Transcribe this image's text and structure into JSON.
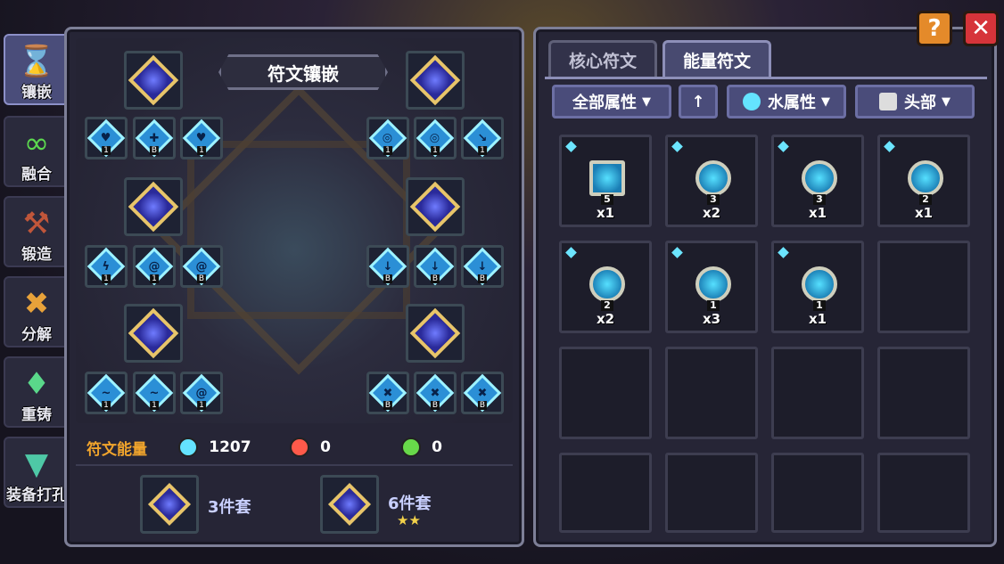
{
  "side_menu": [
    {
      "label": "镶嵌",
      "icon": "inlay-icon",
      "active": true
    },
    {
      "label": "融合",
      "icon": "fusion-icon",
      "active": false
    },
    {
      "label": "锻造",
      "icon": "forge-icon",
      "active": false
    },
    {
      "label": "分解",
      "icon": "decompose-icon",
      "active": false
    },
    {
      "label": "重铸",
      "icon": "recast-icon",
      "active": false
    },
    {
      "label": "装备打孔",
      "icon": "drill-icon",
      "active": false
    }
  ],
  "left_panel": {
    "title": "符文镶嵌",
    "core_slots": 6,
    "rune_rows": [
      {
        "left": [
          "1",
          "B",
          "1"
        ],
        "right": [
          "1",
          "1",
          "1"
        ]
      },
      {
        "left": [
          "1",
          "1",
          "B"
        ],
        "right": [
          "B",
          "B",
          "B"
        ]
      },
      {
        "left": [
          "1",
          "1",
          "1"
        ],
        "right": [
          "B",
          "B",
          "B"
        ]
      }
    ],
    "energy": {
      "title": "符文能量",
      "items": [
        {
          "icon": "water-energy-icon",
          "color": "#64e3ff",
          "value": "1207"
        },
        {
          "icon": "fire-energy-icon",
          "color": "#ff5a4a",
          "value": "0"
        },
        {
          "icon": "nature-energy-icon",
          "color": "#68d94a",
          "value": "0"
        }
      ]
    },
    "sets": [
      {
        "label": "3件套",
        "stars": ""
      },
      {
        "label": "6件套",
        "stars": "★★"
      }
    ]
  },
  "right_panel": {
    "tabs": [
      {
        "label": "核心符文",
        "active": false
      },
      {
        "label": "能量符文",
        "active": true
      }
    ],
    "filters": {
      "attr_all": "全部属性",
      "sort_icon": "arrow-up-icon",
      "water_attr": "水属性",
      "head": "头部"
    },
    "items": [
      {
        "level": "5",
        "count": "x1",
        "shape": "square"
      },
      {
        "level": "3",
        "count": "x2",
        "shape": "round"
      },
      {
        "level": "3",
        "count": "x1",
        "shape": "round"
      },
      {
        "level": "2",
        "count": "x1",
        "shape": "round"
      },
      {
        "level": "2",
        "count": "x2",
        "shape": "round"
      },
      {
        "level": "1",
        "count": "x3",
        "shape": "round"
      },
      {
        "level": "1",
        "count": "x1",
        "shape": "round"
      }
    ],
    "total_cells": 16
  },
  "top_buttons": {
    "help": "?",
    "close": "✕"
  }
}
